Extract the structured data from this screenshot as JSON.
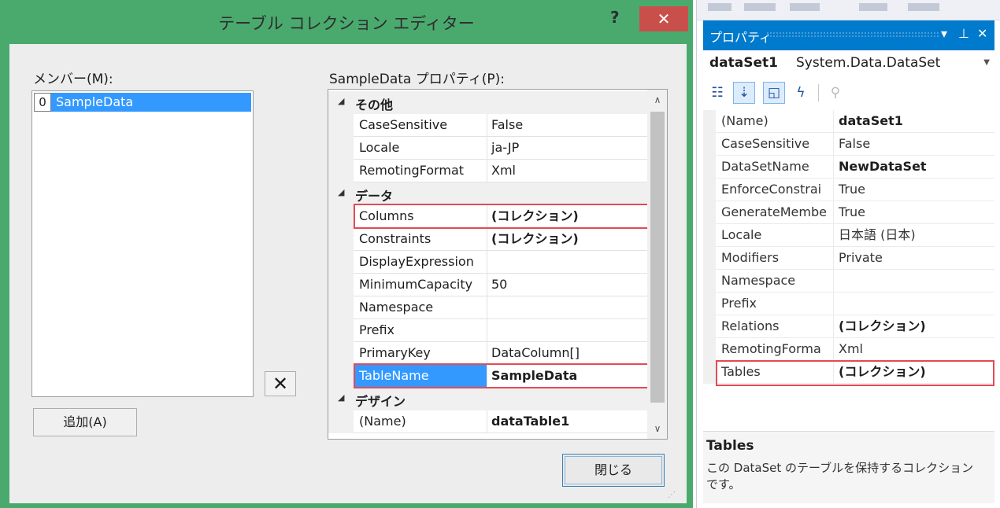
{
  "dialog": {
    "title": "テーブル コレクション エディター",
    "help_label": "?",
    "close_label": "✕",
    "members_label": "メンバー(M):",
    "members": [
      {
        "index": "0",
        "name": "SampleData"
      }
    ],
    "props_label": "SampleData プロパティ(P):",
    "remove_label": "✕",
    "add_label": "追加(A)",
    "close_button_label": "閉じる",
    "grid": {
      "categories": [
        {
          "name": "その他",
          "props": [
            {
              "name": "CaseSensitive",
              "value": "False"
            },
            {
              "name": "Locale",
              "value": "ja-JP"
            },
            {
              "name": "RemotingFormat",
              "value": "Xml"
            }
          ]
        },
        {
          "name": "データ",
          "props": [
            {
              "name": "Columns",
              "value": "(コレクション)"
            },
            {
              "name": "Constraints",
              "value": "(コレクション)"
            },
            {
              "name": "DisplayExpression",
              "value": ""
            },
            {
              "name": "MinimumCapacity",
              "value": "50"
            },
            {
              "name": "Namespace",
              "value": ""
            },
            {
              "name": "Prefix",
              "value": ""
            },
            {
              "name": "PrimaryKey",
              "value": "DataColumn[]"
            },
            {
              "name": "TableName",
              "value": "SampleData"
            }
          ]
        },
        {
          "name": "デザイン",
          "props": [
            {
              "name": "(Name)",
              "value": "dataTable1"
            }
          ]
        }
      ]
    }
  },
  "properties": {
    "title": "プロパティ",
    "pin_label": "▾ ⊥ ✕",
    "object_name": "dataSet1",
    "object_type": "System.Data.DataSet",
    "rows": [
      {
        "name": "(Name)",
        "value": "dataSet1"
      },
      {
        "name": "CaseSensitive",
        "value": "False"
      },
      {
        "name": "DataSetName",
        "value": "NewDataSet"
      },
      {
        "name": "EnforceConstrai",
        "value": "True"
      },
      {
        "name": "GenerateMembe",
        "value": "True"
      },
      {
        "name": "Locale",
        "value": "日本語 (日本)"
      },
      {
        "name": "Modifiers",
        "value": "Private"
      },
      {
        "name": "Namespace",
        "value": ""
      },
      {
        "name": "Prefix",
        "value": ""
      },
      {
        "name": "Relations",
        "value": "(コレクション)"
      },
      {
        "name": "RemotingForma",
        "value": "Xml"
      },
      {
        "name": "Tables",
        "value": "(コレクション)"
      }
    ],
    "desc_title": "Tables",
    "desc_text": "この DataSet のテーブルを保持するコレクションです。"
  }
}
